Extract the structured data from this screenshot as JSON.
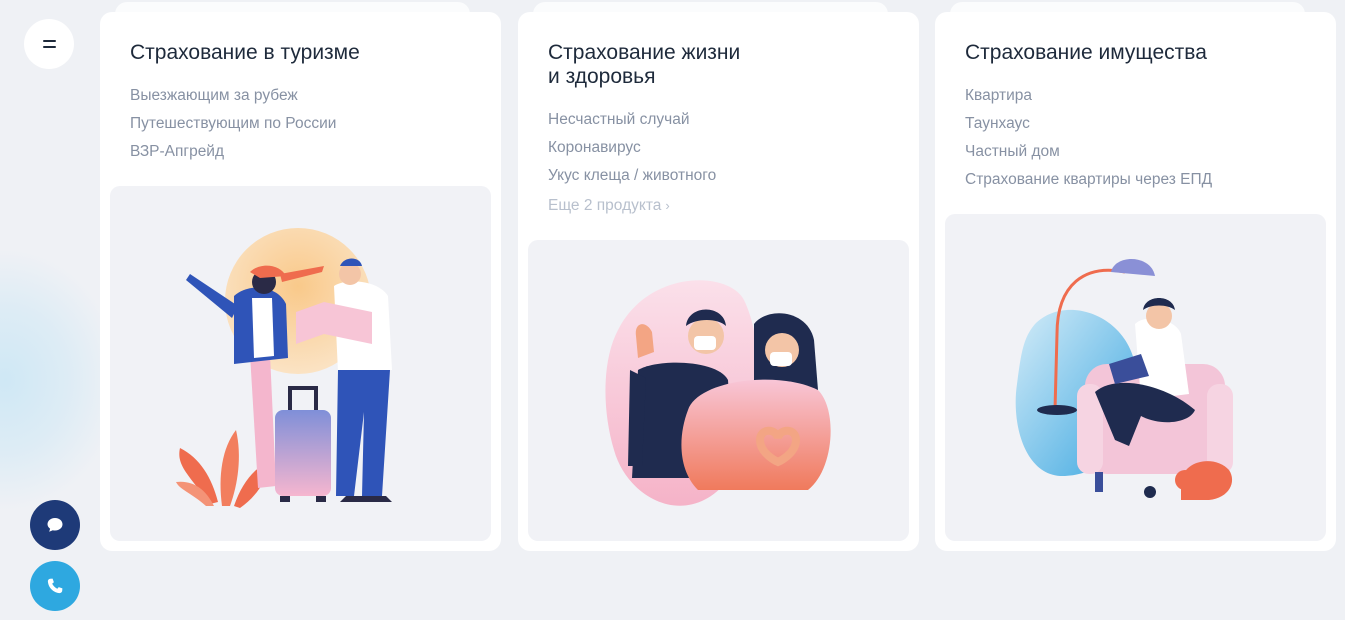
{
  "sidebar": {
    "menu_icon": "menu-icon",
    "chat_icon": "chat-icon",
    "phone_icon": "phone-icon"
  },
  "colors": {
    "accent_dark": "#1e3a78",
    "accent_light": "#2ea8e0",
    "text_dark": "#1e2a3b",
    "text_muted": "#8791a3"
  },
  "cards": [
    {
      "title": "Страхование в туризме",
      "items": [
        "Выезжающим за рубеж",
        "Путешествующим по России",
        "ВЗР-Апгрейд"
      ],
      "illustration_icon": "travelers-illustration"
    },
    {
      "title": "Страхование жизни\nи здоровья",
      "items": [
        "Несчастный случай",
        "Коронавирус",
        "Укус клеща / животного"
      ],
      "more": "Еще 2 продукта",
      "illustration_icon": "masked-people-illustration"
    },
    {
      "title": "Страхование имущества",
      "items": [
        "Квартира",
        "Таунхаус",
        "Частный дом",
        "Страхование квартиры через ЕПД"
      ],
      "illustration_icon": "home-reading-illustration"
    }
  ]
}
